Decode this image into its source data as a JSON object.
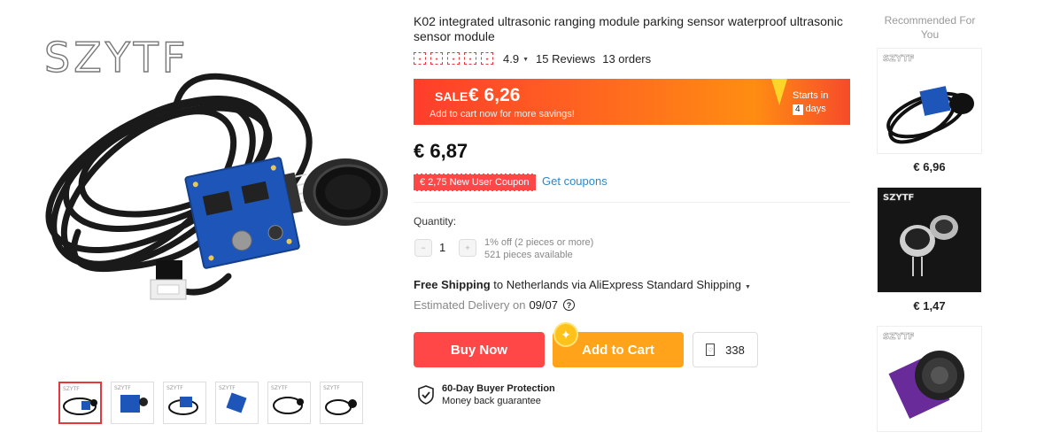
{
  "brand": "SZYTF",
  "product": {
    "title": "K02 integrated ultrasonic ranging module parking sensor waterproof ultrasonic sensor module",
    "rating": "4.9",
    "reviews": "15 Reviews",
    "orders": "13 orders",
    "star_glyph": "★",
    "price": "€ 6,87"
  },
  "sale": {
    "label": "SALE",
    "price": "€ 6,26",
    "subtext": "Add to cart now for more savings!",
    "starts_in": "Starts in",
    "days_count": "4",
    "days_label": "days"
  },
  "coupon": {
    "text": "€ 2,75 New User Coupon",
    "link": "Get coupons"
  },
  "quantity": {
    "label": "Quantity:",
    "value": "1",
    "discount_note": "1% off (2 pieces or more)",
    "available": "521 pieces available"
  },
  "shipping": {
    "free_label": "Free Shipping",
    "rest": " to Netherlands via AliExpress Standard Shipping",
    "estimated_label": "Estimated Delivery on",
    "estimated_date": "09/07",
    "help": "?"
  },
  "actions": {
    "buy_now": "Buy Now",
    "add_to_cart": "Add to Cart",
    "wishlist_count": "338"
  },
  "protection": {
    "title": "60-Day Buyer Protection",
    "subtitle": "Money back guarantee"
  },
  "recommended": {
    "title": "Recommended For You",
    "items": [
      {
        "price": "€ 6,96"
      },
      {
        "price": "€ 1,47"
      },
      {
        "price": ""
      }
    ]
  },
  "thumbnails": [
    "SZYTF",
    "SZYTF",
    "SZYTF",
    "SZYTF",
    "SZYTF",
    "SZYTF"
  ],
  "colors": {
    "accent_red": "#ff4747",
    "accent_orange": "#ffa31a",
    "link_blue": "#2e87c8"
  },
  "icons": {
    "star": "star-icon",
    "caret": "chevron-down-icon",
    "shield": "shield-check-icon",
    "wishlist": "heart-icon"
  }
}
